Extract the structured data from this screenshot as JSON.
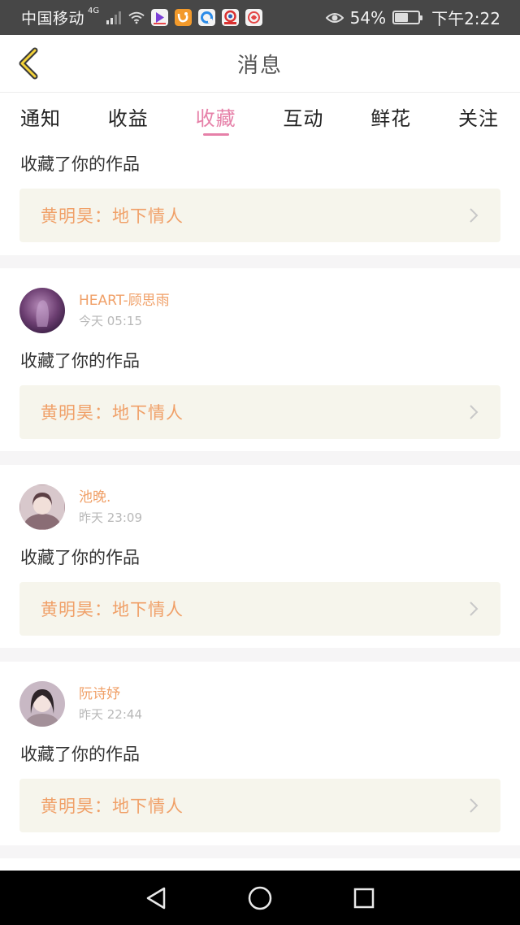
{
  "status_bar": {
    "carrier": "中国移动",
    "network": "4G",
    "battery": "54%",
    "time": "下午2:22",
    "icons": [
      "signal-icon",
      "wifi-icon",
      "video-app-icon",
      "uc-browser-icon",
      "browser-app-icon",
      "news-app-icon",
      "weibo-app-icon",
      "eye-icon",
      "battery-icon"
    ]
  },
  "header": {
    "back_icon": "chevron-left-icon",
    "title": "消息"
  },
  "tabs": [
    {
      "label": "通知",
      "active": false
    },
    {
      "label": "收益",
      "active": false
    },
    {
      "label": "收藏",
      "active": true
    },
    {
      "label": "互动",
      "active": false
    },
    {
      "label": "鲜花",
      "active": false
    },
    {
      "label": "关注",
      "active": false
    }
  ],
  "colors": {
    "accent": "#e680a8",
    "username": "#f0a068",
    "work_bg": "#f6f5ec"
  },
  "notifications": [
    {
      "username": "",
      "time": "",
      "action": "收藏了你的作品",
      "work": "黄明昊：地下情人",
      "partial": true
    },
    {
      "username": "HEART-顾思雨",
      "time": "今天 05:15",
      "action": "收藏了你的作品",
      "work": "黄明昊：地下情人"
    },
    {
      "username": "池晚.",
      "time": "昨天 23:09",
      "action": "收藏了你的作品",
      "work": "黄明昊：地下情人"
    },
    {
      "username": "阮诗妤",
      "time": "昨天 22:44",
      "action": "收藏了你的作品",
      "work": "黄明昊：地下情人"
    }
  ],
  "nav": {
    "back_icon": "triangle-back-icon",
    "home_icon": "circle-home-icon",
    "recents_icon": "square-recents-icon"
  }
}
